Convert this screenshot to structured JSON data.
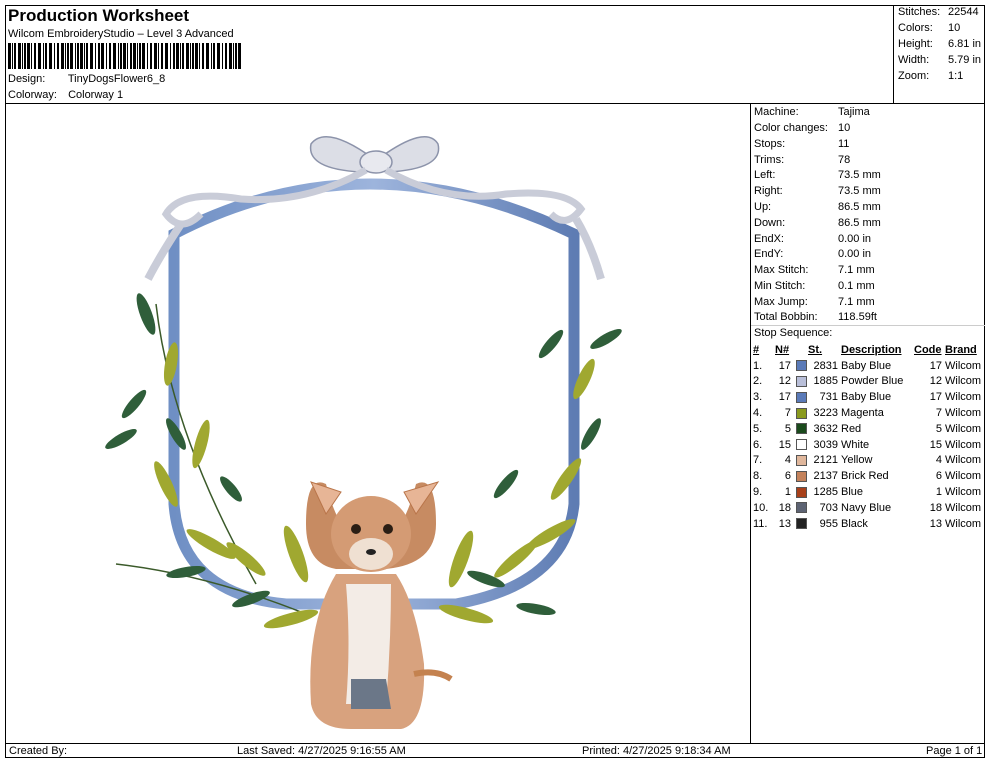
{
  "header": {
    "title": "Production Worksheet",
    "software": "Wilcom EmbroideryStudio – Level 3 Advanced",
    "design_label": "Design:",
    "design_value": "TinyDogsFlower6_8",
    "colorway_label": "Colorway:",
    "colorway_value": "Colorway 1"
  },
  "stats": [
    {
      "label": "Stitches:",
      "value": "22544"
    },
    {
      "label": "Colors:",
      "value": "10"
    },
    {
      "label": "Height:",
      "value": "6.81 in"
    },
    {
      "label": "Width:",
      "value": "5.79 in"
    },
    {
      "label": "Zoom:",
      "value": "1:1"
    }
  ],
  "machine_info": [
    {
      "label": "Machine:",
      "value": "Tajima"
    },
    {
      "label": "Color changes:",
      "value": "10"
    },
    {
      "label": "Stops:",
      "value": "11"
    },
    {
      "label": "Trims:",
      "value": "78"
    },
    {
      "label": "Left:",
      "value": "73.5 mm"
    },
    {
      "label": "Right:",
      "value": "73.5 mm"
    },
    {
      "label": "Up:",
      "value": "86.5 mm"
    },
    {
      "label": "Down:",
      "value": "86.5 mm"
    },
    {
      "label": "EndX:",
      "value": "0.00 in"
    },
    {
      "label": "EndY:",
      "value": "0.00 in"
    },
    {
      "label": "Max Stitch:",
      "value": "7.1 mm"
    },
    {
      "label": "Min Stitch:",
      "value": "0.1 mm"
    },
    {
      "label": "Max Jump:",
      "value": "7.1 mm"
    },
    {
      "label": "Total Bobbin:",
      "value": "118.59ft"
    }
  ],
  "stop_sequence": {
    "title": "Stop Sequence:",
    "headers": {
      "idx": "#",
      "n": "N#",
      "st": "St.",
      "desc": "Description",
      "code": "Code",
      "brand": "Brand"
    },
    "rows": [
      {
        "idx": "1.",
        "n": "17",
        "color": "#5a7ab8",
        "st": "2831",
        "desc": "Baby Blue",
        "code": "17",
        "brand": "Wilcom"
      },
      {
        "idx": "2.",
        "n": "12",
        "color": "#b9bfd9",
        "st": "1885",
        "desc": "Powder Blue",
        "code": "12",
        "brand": "Wilcom"
      },
      {
        "idx": "3.",
        "n": "17",
        "color": "#5a7ab8",
        "st": "731",
        "desc": "Baby Blue",
        "code": "17",
        "brand": "Wilcom"
      },
      {
        "idx": "4.",
        "n": "7",
        "color": "#8a9a1e",
        "st": "3223",
        "desc": "Magenta",
        "code": "7",
        "brand": "Wilcom"
      },
      {
        "idx": "5.",
        "n": "5",
        "color": "#1a4a1c",
        "st": "3632",
        "desc": "Red",
        "code": "5",
        "brand": "Wilcom"
      },
      {
        "idx": "6.",
        "n": "15",
        "color": "#ffffff",
        "st": "3039",
        "desc": "White",
        "code": "15",
        "brand": "Wilcom"
      },
      {
        "idx": "7.",
        "n": "4",
        "color": "#e0b79c",
        "st": "2121",
        "desc": "Yellow",
        "code": "4",
        "brand": "Wilcom"
      },
      {
        "idx": "8.",
        "n": "6",
        "color": "#c4825b",
        "st": "2137",
        "desc": "Brick Red",
        "code": "6",
        "brand": "Wilcom"
      },
      {
        "idx": "9.",
        "n": "1",
        "color": "#a8401a",
        "st": "1285",
        "desc": "Blue",
        "code": "1",
        "brand": "Wilcom"
      },
      {
        "idx": "10.",
        "n": "18",
        "color": "#5d6373",
        "st": "703",
        "desc": "Navy Blue",
        "code": "18",
        "brand": "Wilcom"
      },
      {
        "idx": "11.",
        "n": "13",
        "color": "#222222",
        "st": "955",
        "desc": "Black",
        "code": "13",
        "brand": "Wilcom"
      }
    ]
  },
  "footer": {
    "created": "Created By:",
    "saved": "Last Saved: 4/27/2025 9:16:55 AM",
    "printed": "Printed: 4/27/2025 9:18:34 AM",
    "page": "Page 1 of 1"
  }
}
